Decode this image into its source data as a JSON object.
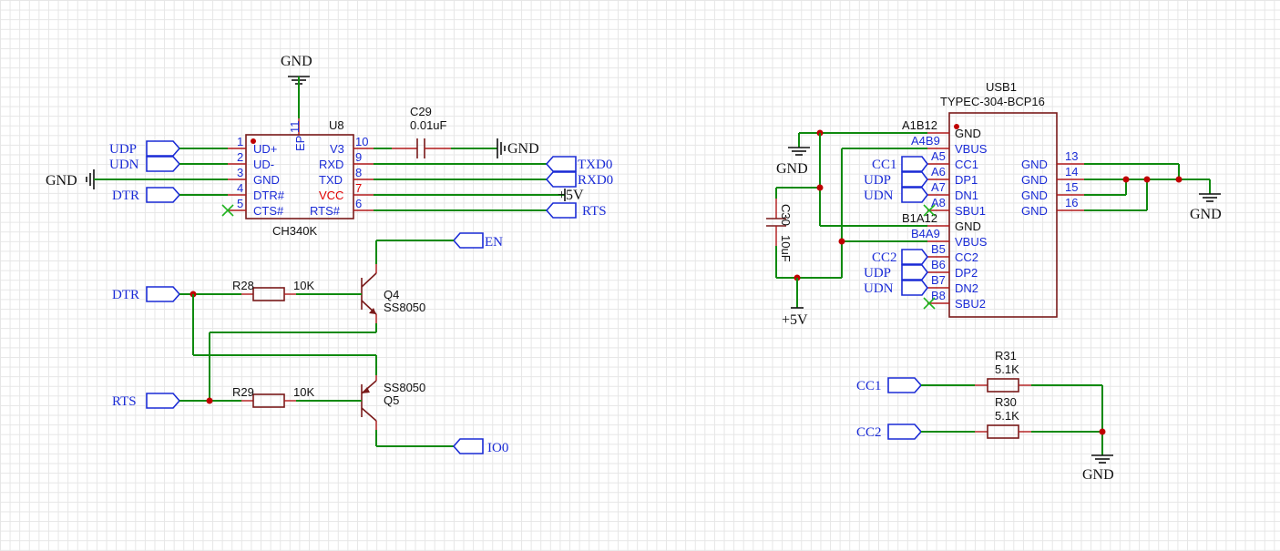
{
  "ch340": {
    "ref": "U8",
    "value": "CH340K",
    "ep_pin": "11",
    "ep_name": "EP",
    "left_pins": [
      {
        "num": "1",
        "name": "UD+"
      },
      {
        "num": "2",
        "name": "UD-"
      },
      {
        "num": "3",
        "name": "GND"
      },
      {
        "num": "4",
        "name": "DTR#"
      },
      {
        "num": "5",
        "name": "CTS#"
      }
    ],
    "right_pins": [
      {
        "num": "10",
        "name": "V3"
      },
      {
        "num": "9",
        "name": "RXD"
      },
      {
        "num": "8",
        "name": "TXD"
      },
      {
        "num": "7",
        "name": "VCC"
      },
      {
        "num": "6",
        "name": "RTS#"
      }
    ]
  },
  "c29": {
    "ref": "C29",
    "value": "0.01uF"
  },
  "c30": {
    "ref": "C30",
    "value": "10uF"
  },
  "q4": {
    "ref": "Q4",
    "value": "SS8050"
  },
  "q5": {
    "ref": "Q5",
    "value": "SS8050"
  },
  "r28": {
    "ref": "R28",
    "value": "10K"
  },
  "r29": {
    "ref": "R29",
    "value": "10K"
  },
  "r30": {
    "ref": "R30",
    "value": "5.1K"
  },
  "r31": {
    "ref": "R31",
    "value": "5.1K"
  },
  "usb": {
    "ref": "USB1",
    "value": "TYPEC-304-BCP16",
    "left_pins": [
      {
        "num": "A1B12",
        "name": "GND"
      },
      {
        "num": "A4B9",
        "name": "VBUS"
      },
      {
        "num": "A5",
        "name": "CC1"
      },
      {
        "num": "A6",
        "name": "DP1"
      },
      {
        "num": "A7",
        "name": "DN1"
      },
      {
        "num": "A8",
        "name": "SBU1"
      },
      {
        "num": "B1A12",
        "name": "GND"
      },
      {
        "num": "B4A9",
        "name": "VBUS"
      },
      {
        "num": "B5",
        "name": "CC2"
      },
      {
        "num": "B6",
        "name": "DP2"
      },
      {
        "num": "B7",
        "name": "DN2"
      },
      {
        "num": "B8",
        "name": "SBU2"
      }
    ],
    "right_pins": [
      {
        "num": "13",
        "name": "GND"
      },
      {
        "num": "14",
        "name": "GND"
      },
      {
        "num": "15",
        "name": "GND"
      },
      {
        "num": "16",
        "name": "GND"
      }
    ]
  },
  "nets": {
    "gnd": "GND",
    "p5v": "+5V",
    "udp": "UDP",
    "udn": "UDN",
    "dtr": "DTR",
    "rts": "RTS",
    "txd0": "TXD0",
    "rxd0": "RXD0",
    "en": "EN",
    "io0": "IO0",
    "cc1": "CC1",
    "cc2": "CC2",
    "udp_usb": "UDP",
    "udn_usb": "UDN"
  }
}
